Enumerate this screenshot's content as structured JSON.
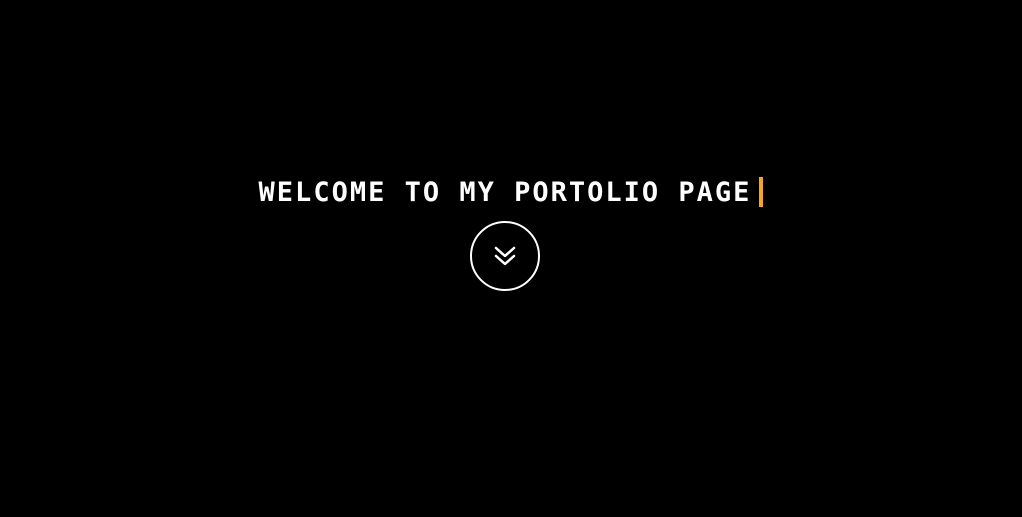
{
  "hero": {
    "headline": "WELCOME TO MY PORTOLIO PAGE",
    "cursor_color": "#f5a623",
    "background_color": "#000000",
    "text_color": "#ffffff",
    "scroll_button_icon": "double-chevron-down-icon"
  }
}
